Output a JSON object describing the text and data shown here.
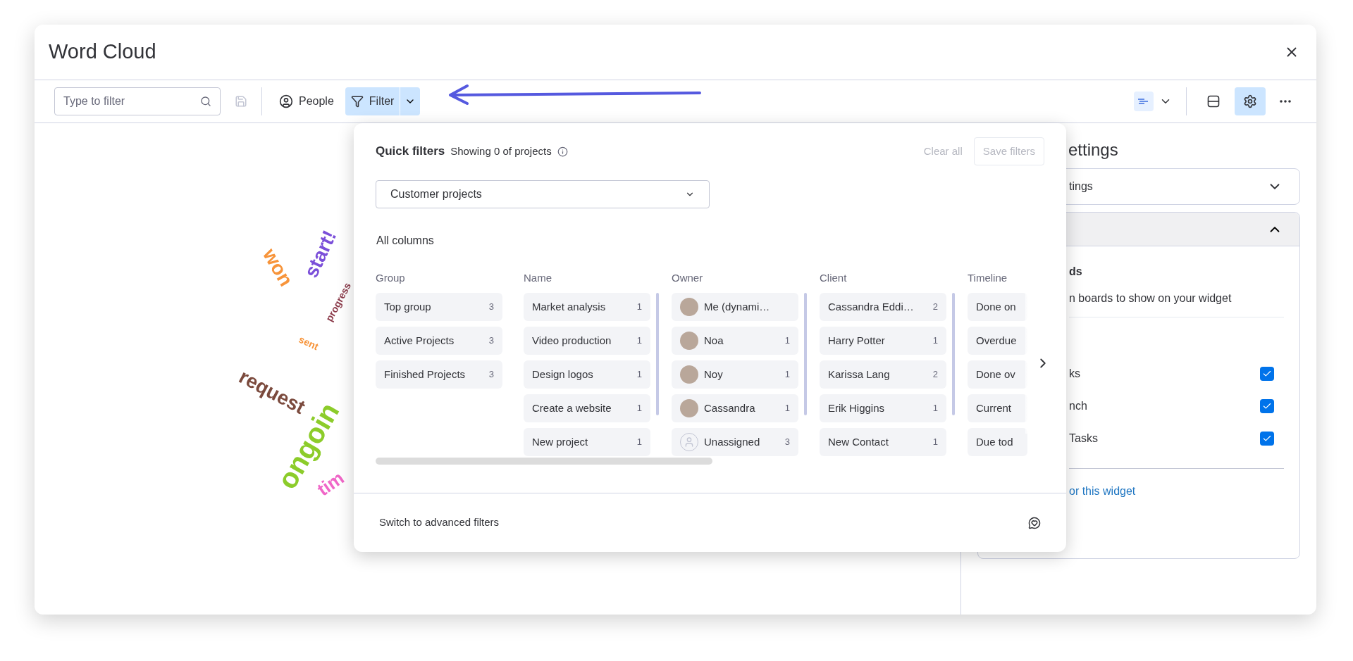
{
  "window": {
    "title": "Word Cloud"
  },
  "toolbar": {
    "search": {
      "placeholder": "Type to filter"
    },
    "people_button": "People",
    "filter_button": {
      "label": "Filter",
      "selected": true
    },
    "settings_button": {
      "selected": true
    }
  },
  "word_cloud": {
    "words": [
      {
        "text": "won",
        "color": "#f7943a"
      },
      {
        "text": "start!",
        "color": "#7b4fd9"
      },
      {
        "text": "progress",
        "color": "#8b3a4a"
      },
      {
        "text": "sent",
        "color": "#f7943a"
      },
      {
        "text": "request",
        "color": "#7b4a3d"
      },
      {
        "text": "ongoin",
        "color": "#8ccc2a"
      },
      {
        "text": "tim",
        "color": "#f067c8"
      }
    ]
  },
  "quick_filters": {
    "title": "Quick filters",
    "status": "Showing 0 of projects",
    "clear_all": {
      "label": "Clear all",
      "disabled": true
    },
    "save_filters": {
      "label": "Save filters",
      "disabled": true
    },
    "board_select": {
      "value": "Customer projects"
    },
    "section_title": "All columns",
    "columns": [
      {
        "title": "Group",
        "items": [
          {
            "label": "Top group",
            "count": "3"
          },
          {
            "label": "Active Projects",
            "count": "3"
          },
          {
            "label": "Finished Projects",
            "count": "3"
          }
        ]
      },
      {
        "title": "Name",
        "items": [
          {
            "label": "Market analysis",
            "count": "1"
          },
          {
            "label": "Video production",
            "count": "1"
          },
          {
            "label": "Design logos",
            "count": "1"
          },
          {
            "label": "Create a website",
            "count": "1"
          },
          {
            "label": "New project",
            "count": "1"
          }
        ]
      },
      {
        "title": "Owner",
        "items": [
          {
            "label": "Me (dynami…",
            "kind": "photo"
          },
          {
            "label": "Noa",
            "count": "1",
            "kind": "photo"
          },
          {
            "label": "Noy",
            "count": "1",
            "kind": "photo"
          },
          {
            "label": "Cassandra",
            "count": "1",
            "kind": "photo"
          },
          {
            "label": "Unassigned",
            "count": "3",
            "kind": "empty"
          }
        ]
      },
      {
        "title": "Client",
        "items": [
          {
            "label": "Cassandra Eddi…",
            "count": "2"
          },
          {
            "label": "Harry Potter",
            "count": "1"
          },
          {
            "label": "Karissa Lang",
            "count": "2"
          },
          {
            "label": "Erik Higgins",
            "count": "1"
          },
          {
            "label": "New Contact",
            "count": "1"
          }
        ]
      },
      {
        "title": "Timeline",
        "items": [
          {
            "label": "Done on"
          },
          {
            "label": "Overdue"
          },
          {
            "label": "Done ov"
          },
          {
            "label": "Current"
          },
          {
            "label": "Due tod"
          }
        ]
      }
    ],
    "footer_link": "Switch to advanced filters"
  },
  "settings_panel": {
    "title": "ettings",
    "sections": [
      {
        "title": "tings",
        "expanded": false
      },
      {
        "expanded": true,
        "heading": "ds",
        "description": "n boards to show on your widget",
        "boards": [
          {
            "label": "ks",
            "checked": true
          },
          {
            "label": "nch",
            "checked": true
          },
          {
            "label": "Tasks",
            "checked": true
          }
        ],
        "link": "or this widget"
      }
    ]
  }
}
